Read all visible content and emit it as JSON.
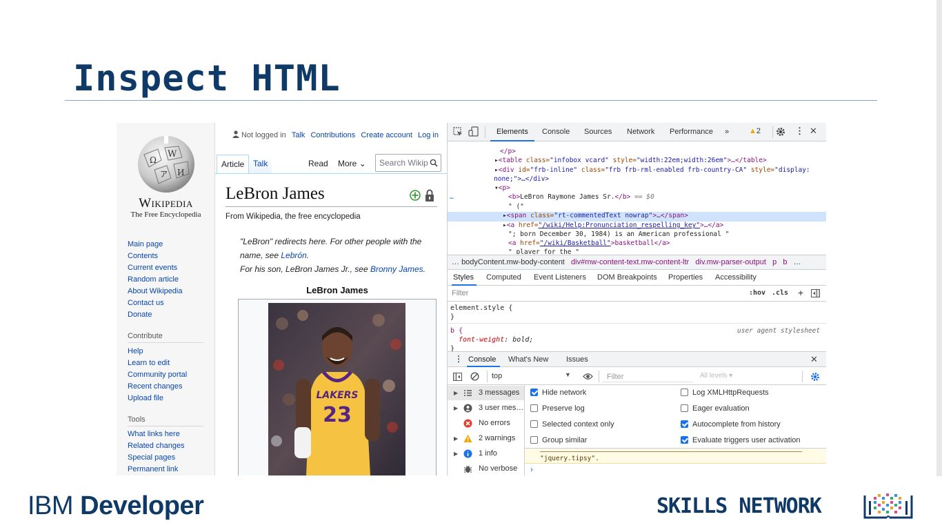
{
  "slide": {
    "title": "Inspect HTML",
    "footer_left": "IBM Developer",
    "footer_left_plain": "IBM ",
    "footer_left_bold": "Developer",
    "footer_right": "SKILLS NETWORK"
  },
  "wiki": {
    "wordmark": "Wikipedia",
    "tagline": "The Free Encyclopedia",
    "user_bar": {
      "not_logged": "Not logged in",
      "links": [
        "Talk",
        "Contributions",
        "Create account",
        "Log in"
      ]
    },
    "tabs": [
      "Article",
      "Talk",
      "Read",
      "More"
    ],
    "search_placeholder": "Search Wikip",
    "nav": [
      "Main page",
      "Contents",
      "Current events",
      "Random article",
      "About Wikipedia",
      "Contact us",
      "Donate"
    ],
    "contribute_heading": "Contribute",
    "contribute": [
      "Help",
      "Learn to edit",
      "Community portal",
      "Recent changes",
      "Upload file"
    ],
    "tools_heading": "Tools",
    "tools": [
      "What links here",
      "Related changes",
      "Special pages",
      "Permanent link"
    ],
    "article_title": "LeBron James",
    "from_line": "From Wikipedia, the free encyclopedia",
    "hatnote": {
      "l1": "\"LeBron\" redirects here. For other people with the",
      "l2a": "name, see ",
      "l2link": "Lebrón",
      "l2b": ".",
      "l3a": "For his son, LeBron James Jr., see ",
      "l3link": "Bronny James",
      "l3b": "."
    },
    "infobox_title": "LeBron James",
    "jersey_team": "LAKERS",
    "jersey_number": "23"
  },
  "devtools": {
    "tabs": [
      "Elements",
      "Console",
      "Sources",
      "Network",
      "Performance",
      "»"
    ],
    "warning_count": "2",
    "tree": {
      "l1": "</p>",
      "l2_tag": "<table ",
      "l2_a1": "class=",
      "l2_v1": "\"infobox vcard\"",
      "l2_a2": " style=",
      "l2_v2": "\"width:22em;width:26em\"",
      "l2_end": ">…</table>",
      "l3_tag": "<div ",
      "l3_a1": "id=",
      "l3_v1": "\"frb-inline\"",
      "l3_a2": " class=",
      "l3_v2": "\"frb frb-rml-enabled frb-country-CA\"",
      "l3_a3": " style=",
      "l3_v3": "\"display:",
      "l4": "none;\">…</div>",
      "l5": "<p>",
      "l6_tag_open": "<b>",
      "l6_text": "LeBron Raymone James Sr.",
      "l6_tag_close": "</b>",
      "l6_sel": " == $0",
      "l7": "\" (\"",
      "l8_tag": "<span ",
      "l8_a": "class=",
      "l8_v": "\"rt-commentedText nowrap\"",
      "l8_end": ">…</span>",
      "l9_tag": "<a ",
      "l9_a": "href=",
      "l9_v": "\"/wiki/Help:Pronunciation_respelling_key\"",
      "l9_end": ">…</a>",
      "l10": "\"; born December 30, 1984) is an American professional \"",
      "l11_tag": "<a ",
      "l11_a": "href=",
      "l11_v": "\"/wiki/Basketball\"",
      "l11_mid": ">basketball</a>",
      "l12": "\" player for the \""
    },
    "breadcrumbs": [
      "bodyContent.mw-body-content",
      "div#mw-content-text.mw-content-ltr",
      "div.mw-parser-output",
      "p",
      "b",
      "…"
    ],
    "subtabs": [
      "Styles",
      "Computed",
      "Event Listeners",
      "DOM Breakpoints",
      "Properties",
      "Accessibility"
    ],
    "filter_placeholder": "Filter",
    "hov": ":hov",
    "cls": ".cls",
    "element_style": "element.style {",
    "close_brace": "}",
    "b_rule": "b {",
    "ua_label": "user agent stylesheet",
    "font_prop": "font-weight",
    "font_val": "bold",
    "drawer_tabs": [
      "Console",
      "What's New",
      "Issues"
    ],
    "context": "top",
    "console_filter": "Filter",
    "levels": "All levels ▾",
    "sidebar": [
      {
        "label": "3 messages",
        "icon": "list-icon"
      },
      {
        "label": "3 user mes…",
        "icon": "user-icon"
      },
      {
        "label": "No errors",
        "icon": "error-icon"
      },
      {
        "label": "2 warnings",
        "icon": "warning-icon"
      },
      {
        "label": "1 info",
        "icon": "info-icon"
      },
      {
        "label": "No verbose",
        "icon": "bug-icon"
      }
    ],
    "settings": {
      "hide_network": "Hide network",
      "preserve_log": "Preserve log",
      "selected_context": "Selected context only",
      "group_similar": "Group similar",
      "log_xhr": "Log XMLHttpRequests",
      "eager_eval": "Eager evaluation",
      "autocomplete": "Autocomplete from history",
      "eval_triggers": "Evaluate triggers user activation"
    },
    "warn_text": "\"jquery.tipsy\".",
    "prompt": "›"
  },
  "colors": {
    "title_blue": "#0f3a68",
    "link_blue": "#0645ad",
    "devtools_accent": "#1a73e8"
  }
}
